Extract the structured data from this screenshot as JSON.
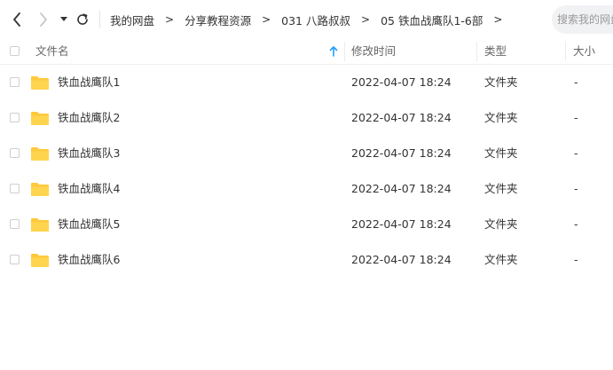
{
  "nav": {
    "back_icon": "chevron-left-icon",
    "forward_icon": "chevron-right-icon",
    "dropdown_icon": "caret-down-icon",
    "refresh_icon": "refresh-icon"
  },
  "breadcrumb": {
    "items": [
      "我的网盘",
      "分享教程资源",
      "031 八路叔叔",
      "05 铁血战鹰队1-6部"
    ],
    "separator": ">"
  },
  "search": {
    "placeholder": "搜索我的网盘"
  },
  "table": {
    "columns": {
      "name": "文件名",
      "modified": "修改时间",
      "type": "类型",
      "size": "大小"
    },
    "sort_icon": "arrow-up-icon",
    "rows": [
      {
        "name": "铁血战鹰队1",
        "modified": "2022-04-07 18:24",
        "type": "文件夹",
        "size": "-"
      },
      {
        "name": "铁血战鹰队2",
        "modified": "2022-04-07 18:24",
        "type": "文件夹",
        "size": "-"
      },
      {
        "name": "铁血战鹰队3",
        "modified": "2022-04-07 18:24",
        "type": "文件夹",
        "size": "-"
      },
      {
        "name": "铁血战鹰队4",
        "modified": "2022-04-07 18:24",
        "type": "文件夹",
        "size": "-"
      },
      {
        "name": "铁血战鹰队5",
        "modified": "2022-04-07 18:24",
        "type": "文件夹",
        "size": "-"
      },
      {
        "name": "铁血战鹰队6",
        "modified": "2022-04-07 18:24",
        "type": "文件夹",
        "size": "-"
      }
    ]
  },
  "colors": {
    "folder": "#ffd54f",
    "sort_arrow": "#1e9fff"
  }
}
